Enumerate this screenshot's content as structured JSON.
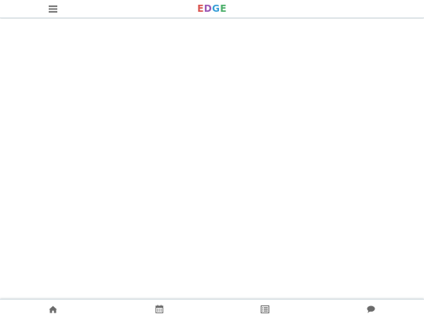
{
  "header": {
    "logo_letters": [
      {
        "char": "E",
        "color": "#d9534f"
      },
      {
        "char": "D",
        "color": "#9b59b6"
      },
      {
        "char": "G",
        "color": "#3aa0d8"
      },
      {
        "char": "E",
        "color": "#4caf6a"
      }
    ],
    "menu_icon": "hamburger-icon"
  },
  "bottom_nav": {
    "items": [
      {
        "icon": "home-icon"
      },
      {
        "icon": "calendar-icon"
      },
      {
        "icon": "list-icon"
      },
      {
        "icon": "chat-icon"
      }
    ]
  },
  "colors": {
    "icon": "#6b6b6b",
    "divider": "#dfe6ea",
    "background": "#ffffff"
  }
}
